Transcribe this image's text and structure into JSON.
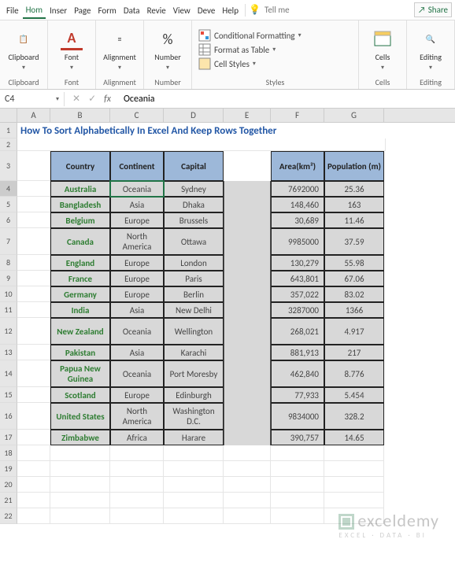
{
  "menu": {
    "tabs": [
      "File",
      "Hom",
      "Inser",
      "Page",
      "Form",
      "Data",
      "Revie",
      "View",
      "Deve",
      "Help"
    ],
    "active_index": 1,
    "tellme": "Tell me",
    "share": "Share"
  },
  "ribbon": {
    "clipboard": {
      "label": "Clipboard",
      "btn": "Clipboard"
    },
    "font": {
      "label": "Font",
      "btn": "Font"
    },
    "alignment": {
      "label": "Alignment",
      "btn": "Alignment"
    },
    "number": {
      "label": "Number",
      "btn": "Number"
    },
    "styles": {
      "label": "Styles",
      "conditional": "Conditional Formatting",
      "table": "Format as Table",
      "cell": "Cell Styles"
    },
    "cells": {
      "label": "Cells",
      "btn": "Cells"
    },
    "editing": {
      "label": "Editing",
      "btn": "Editing"
    }
  },
  "formula_bar": {
    "namebox": "C4",
    "formula": "Oceania"
  },
  "columns": [
    "A",
    "B",
    "C",
    "D",
    "E",
    "F",
    "G"
  ],
  "title": "How To Sort Alphabetically In Excel And Keep Rows Together",
  "headers": {
    "country": "Country",
    "continent": "Continent",
    "capital": "Capital",
    "area": "Area(km²)",
    "population": "Population (m)"
  },
  "rows": [
    {
      "n": 4,
      "country": "Australia",
      "continent": "Oceania",
      "capital": "Sydney",
      "area": "7692000",
      "pop": "25.36"
    },
    {
      "n": 5,
      "country": "Bangladesh",
      "continent": "Asia",
      "capital": "Dhaka",
      "area": "148,460",
      "pop": "163"
    },
    {
      "n": 6,
      "country": "Belgium",
      "continent": "Europe",
      "capital": "Brussels",
      "area": "30,689",
      "pop": "11.46"
    },
    {
      "n": 7,
      "country": "Canada",
      "continent": "North America",
      "capital": "Ottawa",
      "area": "9985000",
      "pop": "37.59"
    },
    {
      "n": 8,
      "country": "England",
      "continent": "Europe",
      "capital": "London",
      "area": "130,279",
      "pop": "55.98"
    },
    {
      "n": 9,
      "country": "France",
      "continent": "Europe",
      "capital": "Paris",
      "area": "643,801",
      "pop": "67.06"
    },
    {
      "n": 10,
      "country": "Germany",
      "continent": "Europe",
      "capital": "Berlin",
      "area": "357,022",
      "pop": "83.02"
    },
    {
      "n": 11,
      "country": "India",
      "continent": "Asia",
      "capital": "New Delhi",
      "area": "3287000",
      "pop": "1366"
    },
    {
      "n": 12,
      "country": "New Zealand",
      "continent": "Oceania",
      "capital": "Wellington",
      "area": "268,021",
      "pop": "4.917"
    },
    {
      "n": 13,
      "country": "Pakistan",
      "continent": "Asia",
      "capital": "Karachi",
      "area": "881,913",
      "pop": "217"
    },
    {
      "n": 14,
      "country": "Papua New Guinea",
      "continent": "Oceania",
      "capital": "Port Moresby",
      "area": "462,840",
      "pop": "8.776"
    },
    {
      "n": 15,
      "country": "Scotland",
      "continent": "Europe",
      "capital": "Edinburgh",
      "area": "77,933",
      "pop": "5.454"
    },
    {
      "n": 16,
      "country": "United States",
      "continent": "North America",
      "capital": "Washington D.C.",
      "area": "9834000",
      "pop": "328.2"
    },
    {
      "n": 17,
      "country": "Zimbabwe",
      "continent": "Africa",
      "capital": "Harare",
      "area": "390,757",
      "pop": "14.65"
    }
  ],
  "empty_rows": [
    18,
    19,
    20,
    21,
    22
  ],
  "watermark": {
    "brand": "exceldemy",
    "tag": "EXCEL · DATA · BI"
  }
}
